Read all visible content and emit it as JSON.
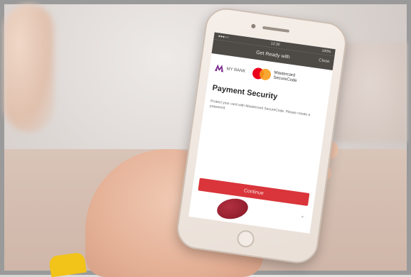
{
  "app": {
    "status_left": "●●●○○",
    "status_time": "12:30",
    "status_right": "100%",
    "header_title": "Get Ready with",
    "header_action": "Close"
  },
  "logos": {
    "bank_name": "MY BANK",
    "mastercard_text": "Mastercard SecureCode"
  },
  "content": {
    "title": "Payment Security",
    "body": "Protect your card with Mastercard SecureCode. Please create a password."
  },
  "actions": {
    "continue_label": "Continue",
    "scroll_icon": "chevron-down-icon"
  },
  "colors": {
    "header_bg": "#4e4b47",
    "button_bg": "#d9353a",
    "mastercard_red": "#eb001b",
    "mastercard_yellow": "#f79e1b",
    "bank_purple": "#7b2d8e"
  }
}
